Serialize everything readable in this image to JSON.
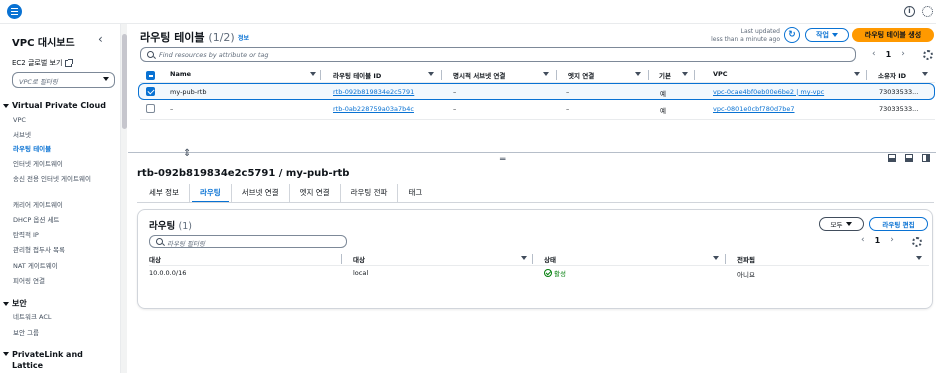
{
  "sidebar": {
    "title": "VPC 대시보드",
    "ec2_global_view": "EC2 글로벌 보기",
    "filter_placeholder": "VPC로 필터링",
    "sections": {
      "vpc_cloud": "Virtual Private Cloud",
      "security": "보안",
      "privatelink": "PrivateLink and Lattice"
    },
    "items": [
      {
        "label": "VPC"
      },
      {
        "label": "서브넷"
      },
      {
        "label": "라우팅 테이블"
      },
      {
        "label": "인터넷 게이트웨이"
      },
      {
        "label": "송신 전용 인터넷 게이트웨이"
      },
      {
        "label": "캐리어 게이트웨이"
      },
      {
        "label": "DHCP 옵션 세트"
      },
      {
        "label": "탄력적 IP"
      },
      {
        "label": "관리형 접두사 목록"
      },
      {
        "label": "NAT 게이트웨이"
      },
      {
        "label": "피어링 연결"
      }
    ],
    "security_items": [
      {
        "label": "네트워크 ACL"
      },
      {
        "label": "보안 그룹"
      }
    ]
  },
  "header": {
    "title": "라우팅 테이블",
    "count": "(1/2)",
    "info": "정보",
    "last_updated_label": "Last updated",
    "last_updated_value": "less than a minute ago",
    "actions": "작업",
    "create": "라우팅 테이블 생성",
    "search_placeholder": "Find resources by attribute or tag",
    "page": "1"
  },
  "table": {
    "columns": [
      "Name",
      "라우팅 테이블 ID",
      "명시적 서브넷 연결",
      "엣지 연결",
      "기본",
      "VPC",
      "소유자 ID"
    ],
    "rows": [
      {
        "name": "my-pub-rtb",
        "id": "rtb-092b819834e2c5791",
        "subnet": "–",
        "edge": "–",
        "main": "예",
        "vpc": "vpc-0cae4bf0eb00e6be2 | my-vpc",
        "owner": "73033533..."
      },
      {
        "name": "–",
        "id": "rtb-0ab228759a03a7b4c",
        "subnet": "–",
        "edge": "–",
        "main": "예",
        "vpc": "vpc-0801e0cbf780d7be7",
        "owner": "73033533..."
      }
    ]
  },
  "detail": {
    "title": "rtb-092b819834e2c5791 / my-pub-rtb",
    "tabs": [
      "세부 정보",
      "라우팅",
      "서브넷 연결",
      "엣지 연결",
      "라우팅 전파",
      "태그"
    ],
    "routes_title": "라우팅",
    "routes_count": "(1)",
    "all_label": "모두",
    "edit_label": "라우팅 편집",
    "route_filter_placeholder": "라우팅 필터링",
    "page": "1",
    "columns": [
      "대상",
      "대상",
      "상태",
      "전파됨"
    ],
    "routes": [
      {
        "destination": "10.0.0.0/16",
        "target": "local",
        "status": "활성",
        "propagated": "아니요"
      }
    ]
  },
  "icons": [
    "menu-icon",
    "info-icon",
    "settings-icon",
    "external-link-icon",
    "refresh-icon",
    "search-icon",
    "gear-icon",
    "status-check-icon"
  ],
  "colors": {
    "accent": "#0972d3",
    "primary_button": "#ff9900",
    "success": "#037f0c"
  }
}
